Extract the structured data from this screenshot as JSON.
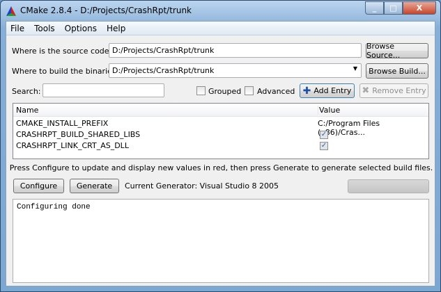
{
  "window": {
    "title": "CMake 2.8.4 - D:/Projects/CrashRpt/trunk",
    "minimize": "_",
    "maximize": "□",
    "close": "X"
  },
  "menu": [
    {
      "label": "File"
    },
    {
      "label": "Tools"
    },
    {
      "label": "Options"
    },
    {
      "label": "Help"
    }
  ],
  "source": {
    "label": "Where is the source code:",
    "value": "D:/Projects/CrashRpt/trunk",
    "browse": "Browse Source..."
  },
  "build": {
    "label": "Where to build the binaries:",
    "value": "D:/Projects/CrashRpt/trunk",
    "browse": "Browse Build..."
  },
  "search": {
    "label": "Search:",
    "value": ""
  },
  "options": {
    "grouped": "Grouped",
    "grouped_checked": false,
    "advanced": "Advanced",
    "advanced_checked": false,
    "add_entry": "Add Entry",
    "remove_entry": "Remove Entry"
  },
  "table": {
    "columns": [
      "Name",
      "Value"
    ],
    "rows": [
      {
        "name": "CMAKE_INSTALL_PREFIX",
        "value": "C:/Program Files (x86)/Cras..."
      },
      {
        "name": "CRASHRPT_BUILD_SHARED_LIBS",
        "checked": true
      },
      {
        "name": "CRASHRPT_LINK_CRT_AS_DLL",
        "checked": true
      }
    ]
  },
  "info": "Press Configure to update and display new values in red, then press Generate to generate selected build files.",
  "actions": {
    "configure": "Configure",
    "generate": "Generate",
    "generator": "Current Generator: Visual Studio 8 2005",
    "progress": 0
  },
  "output": "Configuring done"
}
